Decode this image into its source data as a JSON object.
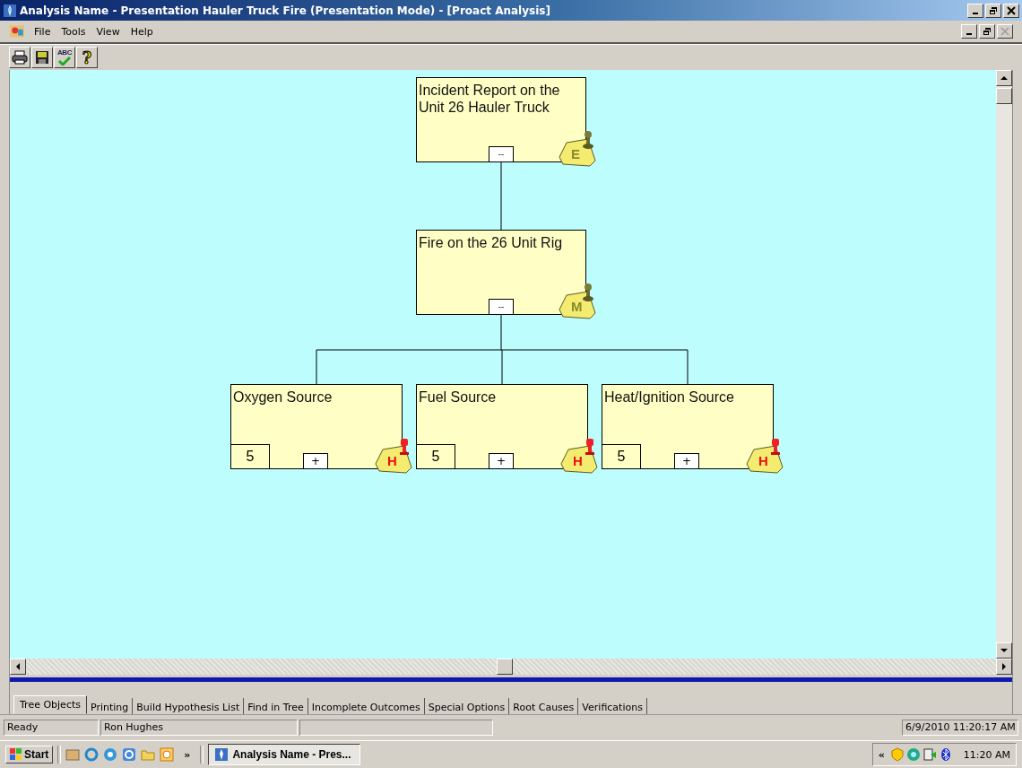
{
  "window": {
    "title": "Analysis Name - Presentation Hauler Truck Fire (Presentation Mode) - [Proact Analysis]"
  },
  "menu": [
    {
      "label": "File"
    },
    {
      "label": "Tools"
    },
    {
      "label": "View"
    },
    {
      "label": "Help"
    }
  ],
  "toolbar": [
    {
      "kind": "print"
    },
    {
      "kind": "save"
    },
    {
      "kind": "spell",
      "label": "ABC"
    },
    {
      "kind": "help",
      "label": "?"
    }
  ],
  "tree": {
    "label": "Incident Report on the Unit 26 Hauler Truck",
    "toggle": "--",
    "expanded": true,
    "note": {
      "letter": "E",
      "color": "#8a8a2a"
    },
    "children": [
      {
        "label": "Fire on the 26 Unit Rig",
        "toggle": "--",
        "expanded": true,
        "note": {
          "letter": "M",
          "color": "#8a8a2a"
        },
        "children": [
          {
            "label": "Oxygen Source",
            "count": "5",
            "toggle": "+",
            "expanded": false,
            "note": {
              "letter": "H",
              "color": "#ee1111"
            }
          },
          {
            "label": "Fuel Source",
            "count": "5",
            "toggle": "+",
            "expanded": false,
            "note": {
              "letter": "H",
              "color": "#ee1111"
            }
          },
          {
            "label": "Heat/Ignition Source",
            "count": "5",
            "toggle": "+",
            "expanded": false,
            "note": {
              "letter": "H",
              "color": "#ee1111"
            }
          }
        ]
      }
    ]
  },
  "tabs": [
    {
      "label": "Tree Objects",
      "selected": true
    },
    {
      "label": "Printing",
      "selected": false
    },
    {
      "label": "Build Hypothesis List",
      "selected": false
    },
    {
      "label": "Find in Tree",
      "selected": false
    },
    {
      "label": "Incomplete Outcomes",
      "selected": false
    },
    {
      "label": "Special Options",
      "selected": false
    },
    {
      "label": "Root Causes",
      "selected": false
    },
    {
      "label": "Verifications",
      "selected": false
    }
  ],
  "status_bar": [
    {
      "text": "Ready"
    },
    {
      "text": "Ron Hughes"
    },
    {
      "text": "6/9/2010 11:20:17 AM"
    }
  ],
  "taskbar": {
    "start": "Start",
    "chevron": "»",
    "task": "Analysis Name - Pres...",
    "tray_chevron": "«",
    "clock": "11:20 AM"
  }
}
